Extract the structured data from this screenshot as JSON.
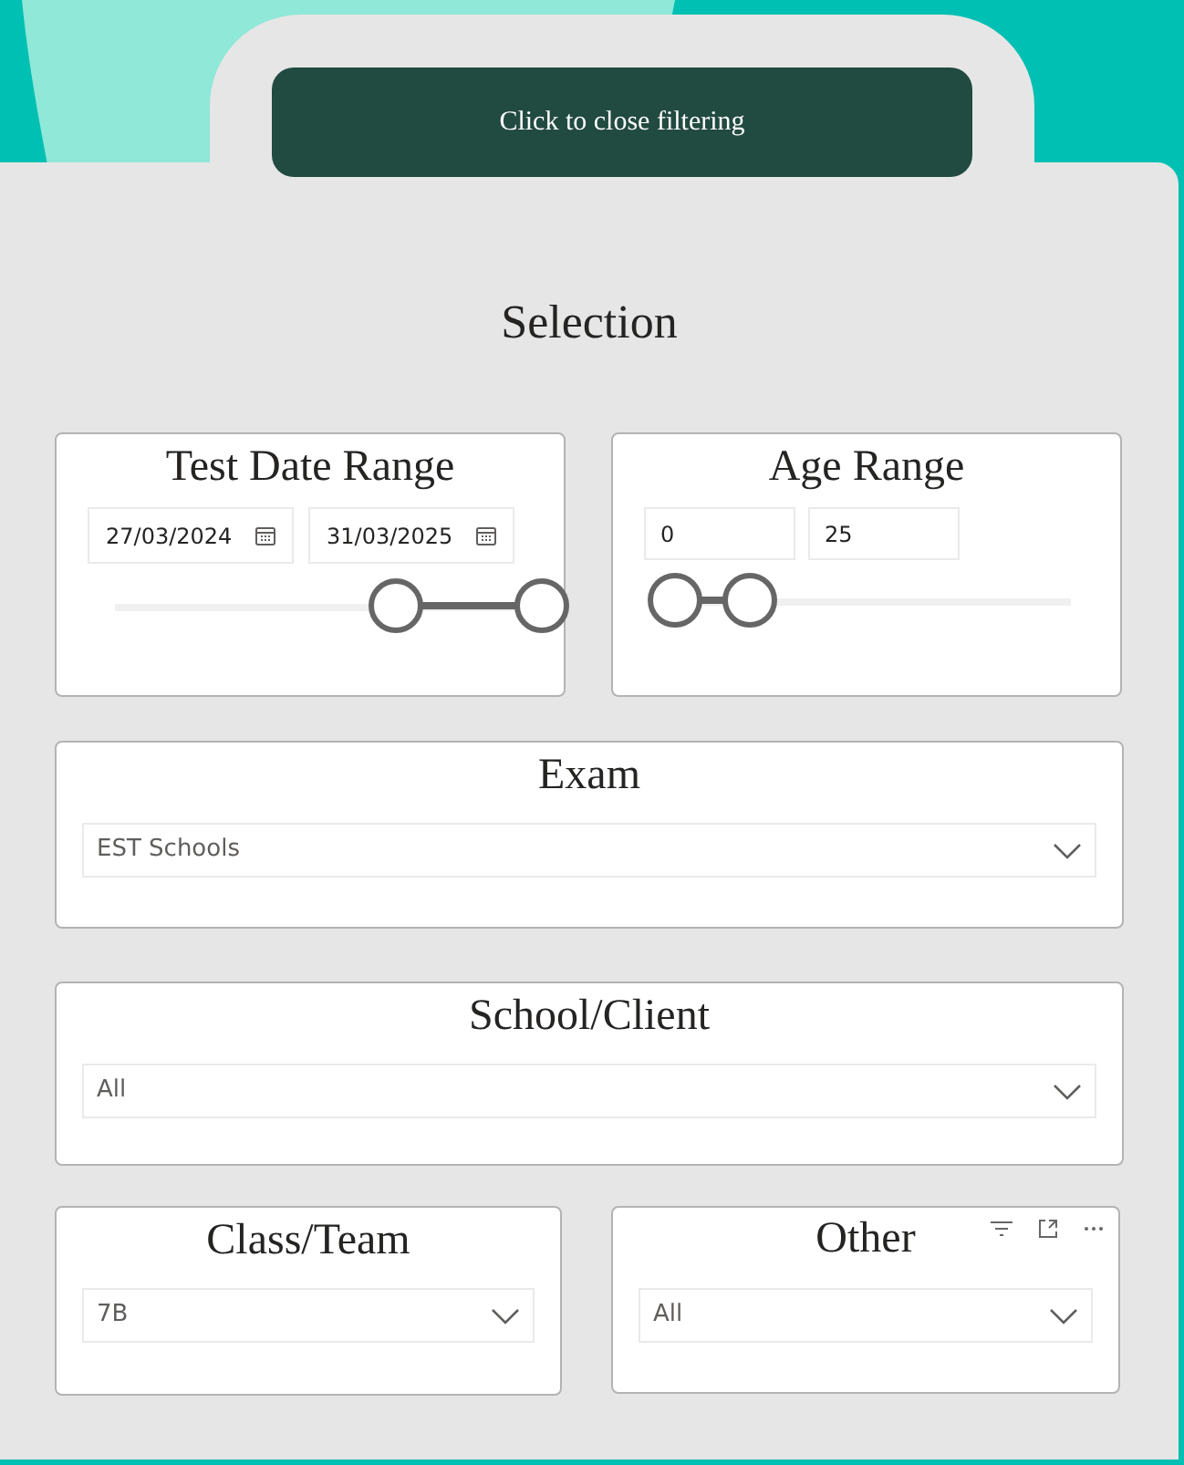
{
  "close_button": "Click to close filtering",
  "title": "Selection",
  "test_date_range": {
    "title": "Test Date Range",
    "from": "27/03/2024",
    "to": "31/03/2025",
    "thumbs": [
      {
        "level": 0.66
      },
      {
        "level": 1
      }
    ]
  },
  "age_range": {
    "title": "Age Range",
    "from": "0",
    "to": "25",
    "thumbs": [
      {
        "level": 0
      },
      {
        "level": 0.19
      }
    ]
  },
  "exam": {
    "title": "Exam",
    "value": "EST Schools"
  },
  "school_client": {
    "title": "School/Client",
    "value": "All"
  },
  "class_team": {
    "title": "Class/Team",
    "value": "7B"
  },
  "other": {
    "title": "Other",
    "value": "All"
  }
}
